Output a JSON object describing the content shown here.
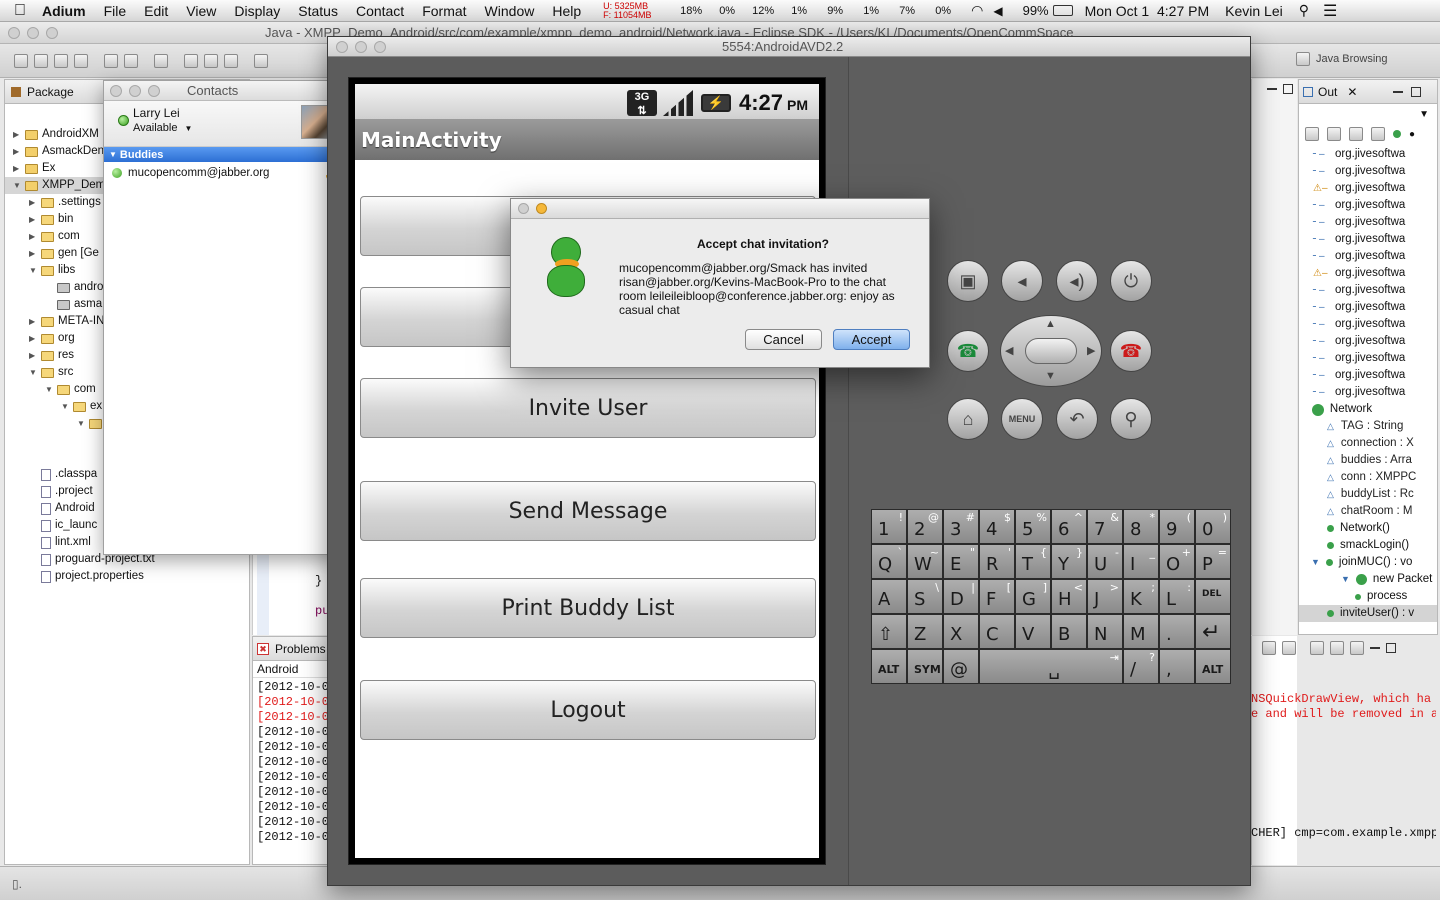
{
  "menubar": {
    "app": "Adium",
    "items": [
      "File",
      "Edit",
      "View",
      "Display",
      "Status",
      "Contact",
      "Format",
      "Window",
      "Help"
    ],
    "mem_u": "U: 5325MB",
    "mem_f": "F: 11054MB",
    "cpu": [
      "18%",
      "0%",
      "12%",
      "1%",
      "9%",
      "1%",
      "7%",
      "0%"
    ],
    "battery": "99%",
    "clock": "Mon Oct 1  4:27 PM",
    "user": "Kevin Lei"
  },
  "eclipse": {
    "window_title": "Java - XMPP_Demo_Android/src/com/example/xmpp_demo_android/Network.java - Eclipse SDK - /Users/KL/Documents/OpenCommSpace",
    "perspective": "Java Browsing",
    "package_tab": "Package",
    "tree": [
      {
        "label": "AndroidXM",
        "indent": 0,
        "kind": "proj",
        "open": false
      },
      {
        "label": "AsmackDen",
        "indent": 0,
        "kind": "proj",
        "open": false
      },
      {
        "label": "Ex",
        "indent": 0,
        "kind": "proj",
        "open": false
      },
      {
        "label": "XMPP_Dem",
        "indent": 0,
        "kind": "proj",
        "open": true
      },
      {
        "label": ".settings",
        "indent": 1,
        "kind": "fold",
        "open": false
      },
      {
        "label": "bin",
        "indent": 1,
        "kind": "fold",
        "open": false
      },
      {
        "label": "com",
        "indent": 1,
        "kind": "fold",
        "open": false
      },
      {
        "label": "gen [Ge",
        "indent": 1,
        "kind": "fold",
        "open": false
      },
      {
        "label": "libs",
        "indent": 1,
        "kind": "fold",
        "open": true
      },
      {
        "label": "andro",
        "indent": 2,
        "kind": "jar",
        "open": null
      },
      {
        "label": "asma",
        "indent": 2,
        "kind": "jar",
        "open": null
      },
      {
        "label": "META-IN",
        "indent": 1,
        "kind": "fold",
        "open": false
      },
      {
        "label": "org",
        "indent": 1,
        "kind": "fold",
        "open": false
      },
      {
        "label": "res",
        "indent": 1,
        "kind": "fold",
        "open": false
      },
      {
        "label": "src",
        "indent": 1,
        "kind": "fold",
        "open": true
      },
      {
        "label": "com",
        "indent": 2,
        "kind": "fold",
        "open": true
      },
      {
        "label": "ex",
        "indent": 3,
        "kind": "fold",
        "open": true
      },
      {
        "label": "",
        "indent": 4,
        "kind": "fold",
        "open": true
      },
      {
        "label": "",
        "indent": 4,
        "kind": "blank",
        "open": null
      },
      {
        "label": "",
        "indent": 5,
        "kind": "fold",
        "open": null
      },
      {
        "label": ".classpa",
        "indent": 1,
        "kind": "file",
        "open": null
      },
      {
        "label": ".project",
        "indent": 1,
        "kind": "file",
        "open": null
      },
      {
        "label": "Android",
        "indent": 1,
        "kind": "file",
        "open": null
      },
      {
        "label": "ic_launc",
        "indent": 1,
        "kind": "file",
        "open": null
      },
      {
        "label": "lint.xml",
        "indent": 1,
        "kind": "file",
        "open": null
      },
      {
        "label": "proguard-project.txt",
        "indent": 1,
        "kind": "file",
        "open": null
      },
      {
        "label": "project.properties",
        "indent": 1,
        "kind": "file",
        "open": null
      }
    ],
    "editor_fragments": [
      "}",
      "pu"
    ],
    "problems_tab": "Problems",
    "console_header": "Android",
    "console_lines": [
      {
        "text": "[2012-10-0",
        "red": false
      },
      {
        "text": "[2012-10-0",
        "red": true
      },
      {
        "text": "[2012-10-0",
        "red": true
      },
      {
        "text": "[2012-10-0",
        "red": false
      },
      {
        "text": "[2012-10-0",
        "red": false
      },
      {
        "text": "[2012-10-0",
        "red": false
      },
      {
        "text": "[2012-10-0",
        "red": false
      },
      {
        "text": "[2012-10-0",
        "red": false
      },
      {
        "text": "[2012-10-0",
        "red": false
      },
      {
        "text": "[2012-10-0",
        "red": false
      },
      {
        "text": "[2012-10-0",
        "red": false
      }
    ],
    "console_right": [
      {
        "text": "NSQuickDrawView, which ha",
        "red": true
      },
      {
        "text": "e and will be removed in a",
        "red": true
      },
      {
        "text": "CHER] cmp=com.example.xmpp",
        "red": false
      }
    ],
    "outline_tab": "Out",
    "outline": [
      {
        "label": "org.jivesoftwa",
        "kind": "import",
        "indent": 0
      },
      {
        "label": "org.jivesoftwa",
        "kind": "import",
        "indent": 0
      },
      {
        "label": "org.jivesoftwa",
        "kind": "import-warn",
        "indent": 0
      },
      {
        "label": "org.jivesoftwa",
        "kind": "import",
        "indent": 0
      },
      {
        "label": "org.jivesoftwa",
        "kind": "import",
        "indent": 0
      },
      {
        "label": "org.jivesoftwa",
        "kind": "import",
        "indent": 0
      },
      {
        "label": "org.jivesoftwa",
        "kind": "import",
        "indent": 0
      },
      {
        "label": "org.jivesoftwa",
        "kind": "import-warn",
        "indent": 0
      },
      {
        "label": "org.jivesoftwa",
        "kind": "import",
        "indent": 0
      },
      {
        "label": "org.jivesoftwa",
        "kind": "import",
        "indent": 0
      },
      {
        "label": "org.jivesoftwa",
        "kind": "import",
        "indent": 0
      },
      {
        "label": "org.jivesoftwa",
        "kind": "import",
        "indent": 0
      },
      {
        "label": "org.jivesoftwa",
        "kind": "import",
        "indent": 0
      },
      {
        "label": "org.jivesoftwa",
        "kind": "import",
        "indent": 0
      },
      {
        "label": "org.jivesoftwa",
        "kind": "import",
        "indent": 0
      },
      {
        "label": "Network",
        "kind": "class",
        "indent": 0
      },
      {
        "label": "TAG : String",
        "kind": "field-sf",
        "indent": 1
      },
      {
        "label": "connection : X",
        "kind": "field",
        "indent": 1
      },
      {
        "label": "buddies : Arra",
        "kind": "field",
        "indent": 1
      },
      {
        "label": "conn : XMPPC",
        "kind": "field",
        "indent": 1
      },
      {
        "label": "buddyList : Rc",
        "kind": "field",
        "indent": 1
      },
      {
        "label": "chatRoom : M",
        "kind": "field",
        "indent": 1
      },
      {
        "label": "Network()",
        "kind": "method-c",
        "indent": 1
      },
      {
        "label": "smackLogin()",
        "kind": "method",
        "indent": 1
      },
      {
        "label": "joinMUC() : vo",
        "kind": "method",
        "indent": 1
      },
      {
        "label": "new Packet",
        "kind": "anon",
        "indent": 2
      },
      {
        "label": "process",
        "kind": "method-small",
        "indent": 3
      },
      {
        "label": "inviteUser() : v",
        "kind": "method-sel",
        "indent": 1
      }
    ]
  },
  "contacts": {
    "window_title": "Contacts",
    "user_name": "Larry Lei",
    "status": "Available",
    "group": "Buddies",
    "buddies": [
      "mucopencomm@jabber.org"
    ]
  },
  "emulator": {
    "window_title": "5554:AndroidAVD2.2",
    "time": "4:27",
    "ampm": "PM",
    "app_title": "MainActivity",
    "buttons": [
      "",
      "",
      "Invite User",
      "Send Message",
      "Print Buddy List",
      "Logout"
    ],
    "hw_buttons": [
      "camera",
      "vol-down",
      "vol-up",
      "power",
      "call",
      "end",
      "home",
      "menu",
      "back",
      "search"
    ],
    "menu_label": "MENU",
    "keyboard": {
      "row1": [
        [
          "1",
          "!"
        ],
        [
          "2",
          "@"
        ],
        [
          "3",
          "#"
        ],
        [
          "4",
          "$"
        ],
        [
          "5",
          "%"
        ],
        [
          "6",
          "^"
        ],
        [
          "7",
          "&"
        ],
        [
          "8",
          "*"
        ],
        [
          "9",
          "("
        ],
        [
          "0",
          ")"
        ]
      ],
      "row2": [
        [
          "Q",
          "`"
        ],
        [
          "W",
          "~"
        ],
        [
          "E",
          "\""
        ],
        [
          "R",
          "'"
        ],
        [
          "T",
          "{"
        ],
        [
          "Y",
          "}"
        ],
        [
          "U",
          "-"
        ],
        [
          "I",
          "_"
        ],
        [
          "O",
          "+"
        ],
        [
          "P",
          "="
        ]
      ],
      "row3": [
        [
          "A",
          ""
        ],
        [
          "S",
          "\\"
        ],
        [
          "D",
          "|"
        ],
        [
          "F",
          "["
        ],
        [
          "G",
          "]"
        ],
        [
          "H",
          "<"
        ],
        [
          "J",
          ">"
        ],
        [
          "K",
          ";"
        ],
        [
          "L",
          ":"
        ],
        [
          "DEL",
          ""
        ]
      ],
      "row4": [
        [
          "⇧",
          ""
        ],
        [
          "Z",
          ""
        ],
        [
          "X",
          ""
        ],
        [
          "C",
          ""
        ],
        [
          "V",
          ""
        ],
        [
          "B",
          ""
        ],
        [
          "N",
          ""
        ],
        [
          "M",
          ""
        ],
        [
          ".",
          ""
        ],
        [
          "↵",
          ""
        ]
      ],
      "row5_alt": "ALT",
      "row5_sym": "SYM",
      "row5_at": "@",
      "row5_slash": "/",
      "row5_comma": ",",
      "row5_alt2": "ALT"
    }
  },
  "dialog": {
    "title": "Accept chat invitation?",
    "message": "mucopencomm@jabber.org/Smack has invited risan@jabber.org/Kevins-MacBook-Pro to the chat room leileileibloop@conference.jabber.org: enjoy as casual chat",
    "cancel": "Cancel",
    "accept": "Accept"
  },
  "colors": {
    "accent": "#3b7ad8",
    "selection": "#2d6fd6",
    "error": "#e01b1b"
  }
}
